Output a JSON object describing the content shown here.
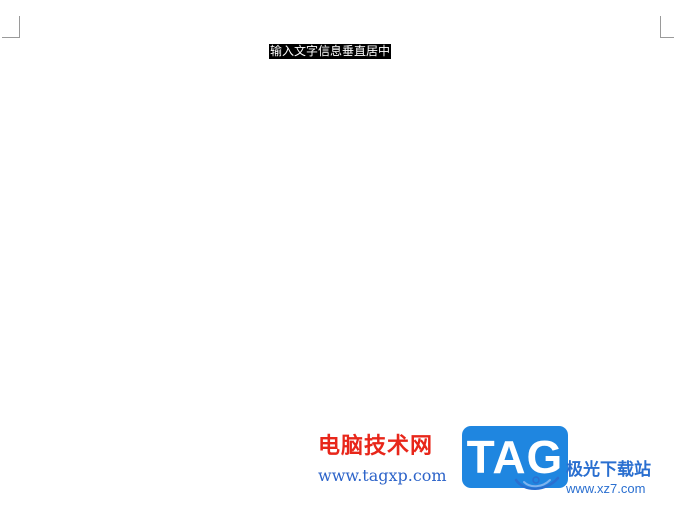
{
  "document": {
    "selected_text": "输入文字信息垂直居中"
  },
  "watermark": {
    "title": "电脑技术网",
    "url": "www.tagxp.com",
    "logo_text": "TAG",
    "site_name": "极光下载站",
    "site_url": "www.xz7.com",
    "colors": {
      "title": "#e8261a",
      "url": "#2c63c9",
      "logo_bg": "#1f86e0",
      "site": "#2a6fd0"
    }
  }
}
